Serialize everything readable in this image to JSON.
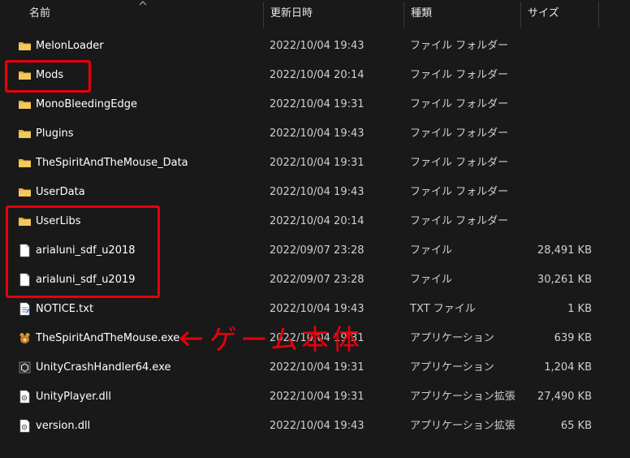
{
  "columns": {
    "name": "名前",
    "date": "更新日時",
    "type": "種類",
    "size": "サイズ"
  },
  "files": [
    {
      "name": "MelonLoader",
      "date": "2022/10/04 19:43",
      "type": "ファイル フォルダー",
      "size": "",
      "icon": "folder-icon"
    },
    {
      "name": "Mods",
      "date": "2022/10/04 20:14",
      "type": "ファイル フォルダー",
      "size": "",
      "icon": "folder-icon"
    },
    {
      "name": "MonoBleedingEdge",
      "date": "2022/10/04 19:31",
      "type": "ファイル フォルダー",
      "size": "",
      "icon": "folder-icon"
    },
    {
      "name": "Plugins",
      "date": "2022/10/04 19:43",
      "type": "ファイル フォルダー",
      "size": "",
      "icon": "folder-icon"
    },
    {
      "name": "TheSpiritAndTheMouse_Data",
      "date": "2022/10/04 19:31",
      "type": "ファイル フォルダー",
      "size": "",
      "icon": "folder-icon"
    },
    {
      "name": "UserData",
      "date": "2022/10/04 19:43",
      "type": "ファイル フォルダー",
      "size": "",
      "icon": "folder-icon"
    },
    {
      "name": "UserLibs",
      "date": "2022/10/04 20:14",
      "type": "ファイル フォルダー",
      "size": "",
      "icon": "folder-icon"
    },
    {
      "name": "arialuni_sdf_u2018",
      "date": "2022/09/07 23:28",
      "type": "ファイル",
      "size": "28,491 KB",
      "icon": "file-icon"
    },
    {
      "name": "arialuni_sdf_u2019",
      "date": "2022/09/07 23:28",
      "type": "ファイル",
      "size": "30,261 KB",
      "icon": "file-icon"
    },
    {
      "name": "NOTICE.txt",
      "date": "2022/10/04 19:43",
      "type": "TXT ファイル",
      "size": "1 KB",
      "icon": "text-file-icon"
    },
    {
      "name": "TheSpiritAndTheMouse.exe",
      "date": "2022/10/04 19:31",
      "type": "アプリケーション",
      "size": "639 KB",
      "icon": "game-exe-icon"
    },
    {
      "name": "UnityCrashHandler64.exe",
      "date": "2022/10/04 19:31",
      "type": "アプリケーション",
      "size": "1,204 KB",
      "icon": "unity-exe-icon"
    },
    {
      "name": "UnityPlayer.dll",
      "date": "2022/10/04 19:31",
      "type": "アプリケーション拡張",
      "size": "27,490 KB",
      "icon": "dll-file-icon"
    },
    {
      "name": "version.dll",
      "date": "2022/10/04 19:43",
      "type": "アプリケーション拡張",
      "size": "65 KB",
      "icon": "dll-file-icon"
    }
  ],
  "annotation": {
    "text": "ゲーム本体",
    "color": "#e8000b"
  },
  "colors": {
    "background": "#191919",
    "highlight": "#e8000b",
    "folder": "#f2c45a"
  }
}
